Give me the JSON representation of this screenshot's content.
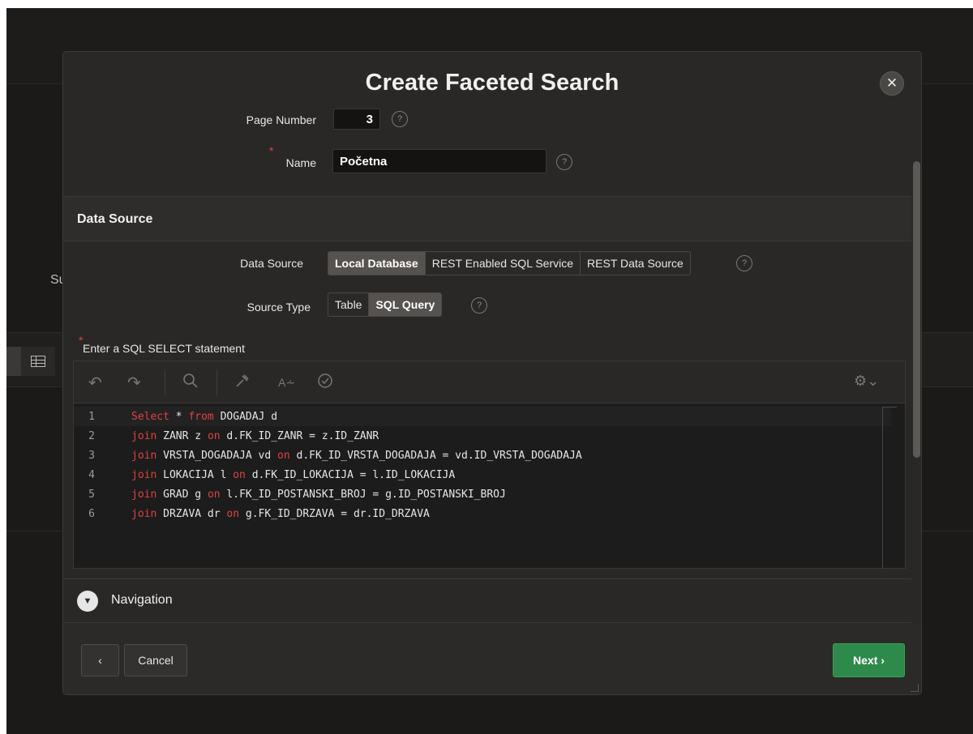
{
  "dialog": {
    "title": "Create Faceted Search",
    "close_icon": "close-icon"
  },
  "page_number": {
    "label": "Page Number",
    "value": "3",
    "help": "?"
  },
  "name": {
    "label": "Name",
    "value": "Početna",
    "required": "*",
    "help": "?"
  },
  "data_source_section": {
    "title": "Data Source",
    "data_source": {
      "label": "Data Source",
      "options": [
        "Local Database",
        "REST Enabled SQL Service",
        "REST Data Source"
      ],
      "selected": "Local Database",
      "help": "?"
    },
    "source_type": {
      "label": "Source Type",
      "options": [
        "Table",
        "SQL Query"
      ],
      "selected": "SQL Query",
      "help": "?"
    },
    "sql": {
      "label": "Enter a SQL SELECT statement",
      "required": "*",
      "lines": [
        {
          "num": "1",
          "parts": [
            {
              "t": "Select",
              "kw": true
            },
            {
              "t": " * "
            },
            {
              "t": "from",
              "kw": true
            },
            {
              "t": " DOGADAJ d"
            }
          ]
        },
        {
          "num": "2",
          "parts": [
            {
              "t": "join",
              "kw": true
            },
            {
              "t": " ZANR z "
            },
            {
              "t": "on",
              "kw": true
            },
            {
              "t": " d.FK_ID_ZANR = z.ID_ZANR"
            }
          ]
        },
        {
          "num": "3",
          "parts": [
            {
              "t": "join",
              "kw": true
            },
            {
              "t": " VRSTA_DOGADAJA vd "
            },
            {
              "t": "on",
              "kw": true
            },
            {
              "t": " d.FK_ID_VRSTA_DOGADAJA = vd.ID_VRSTA_DOGADAJA"
            }
          ]
        },
        {
          "num": "4",
          "parts": [
            {
              "t": "join",
              "kw": true
            },
            {
              "t": " LOKACIJA l "
            },
            {
              "t": "on",
              "kw": true
            },
            {
              "t": " d.FK_ID_LOKACIJA = l.ID_LOKACIJA"
            }
          ]
        },
        {
          "num": "5",
          "parts": [
            {
              "t": "join",
              "kw": true
            },
            {
              "t": " GRAD g "
            },
            {
              "t": "on",
              "kw": true
            },
            {
              "t": " l.FK_ID_POSTANSKI_BROJ = g.ID_POSTANSKI_BROJ"
            }
          ]
        },
        {
          "num": "6",
          "parts": [
            {
              "t": "join",
              "kw": true
            },
            {
              "t": " DRZAVA dr "
            },
            {
              "t": "on",
              "kw": true
            },
            {
              "t": " g.FK_ID_DRZAVA = dr.ID_DRZAVA"
            }
          ]
        }
      ],
      "toolbar_icons": [
        "undo-icon",
        "redo-icon",
        "search-icon",
        "format-wrench-icon",
        "autocomplete-icon",
        "validate-check-icon",
        "settings-gear-icon"
      ]
    }
  },
  "navigation": {
    "label": "Navigation"
  },
  "footer": {
    "back_label": "‹",
    "cancel_label": "Cancel",
    "next_label": "Next ›"
  },
  "background": {
    "partial_label": "Su"
  },
  "colors": {
    "accent_green": "#2d8a4a",
    "keyword_red": "#e0433c",
    "dialog_bg": "#2a2826"
  }
}
